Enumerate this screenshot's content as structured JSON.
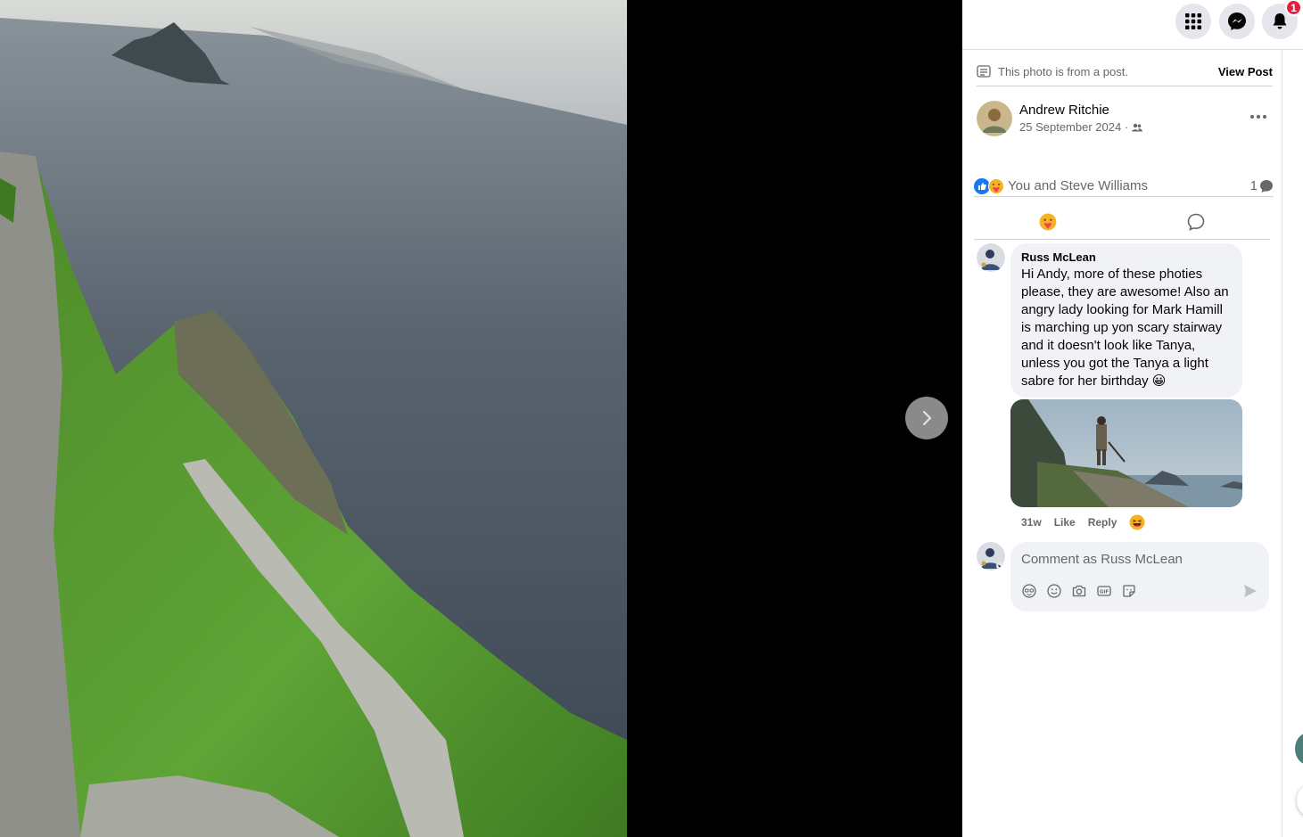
{
  "topbar": {
    "apps_icon": "grid-icon",
    "messenger_icon": "messenger-icon",
    "notifications_icon": "bell-icon",
    "notification_count": "1"
  },
  "post_note": {
    "text": "This photo is from a post.",
    "view_post_label": "View Post"
  },
  "author": {
    "name": "Andrew Ritchie",
    "date": "25 September 2024 ·",
    "audience_icon": "friends-icon"
  },
  "reactions": {
    "summary": "You and Steve Williams",
    "comment_count": "1"
  },
  "comments": [
    {
      "name": "Russ McLean",
      "text": "Hi Andy, more of these photies please, they are awesome! Also an angry lady looking for Mark Hamill is marching up yon scary stairway and it doesn't look like Tanya, unless you got the Tanya a light sabre for her birthday 😀",
      "time": "31w",
      "like_label": "Like",
      "reply_label": "Reply"
    }
  ],
  "compose": {
    "placeholder": "Comment as Russ McLean"
  },
  "colors": {
    "like_blue": "#1877f2",
    "badge_red": "#e41e3f",
    "bubble_grey": "#f0f2f5"
  }
}
